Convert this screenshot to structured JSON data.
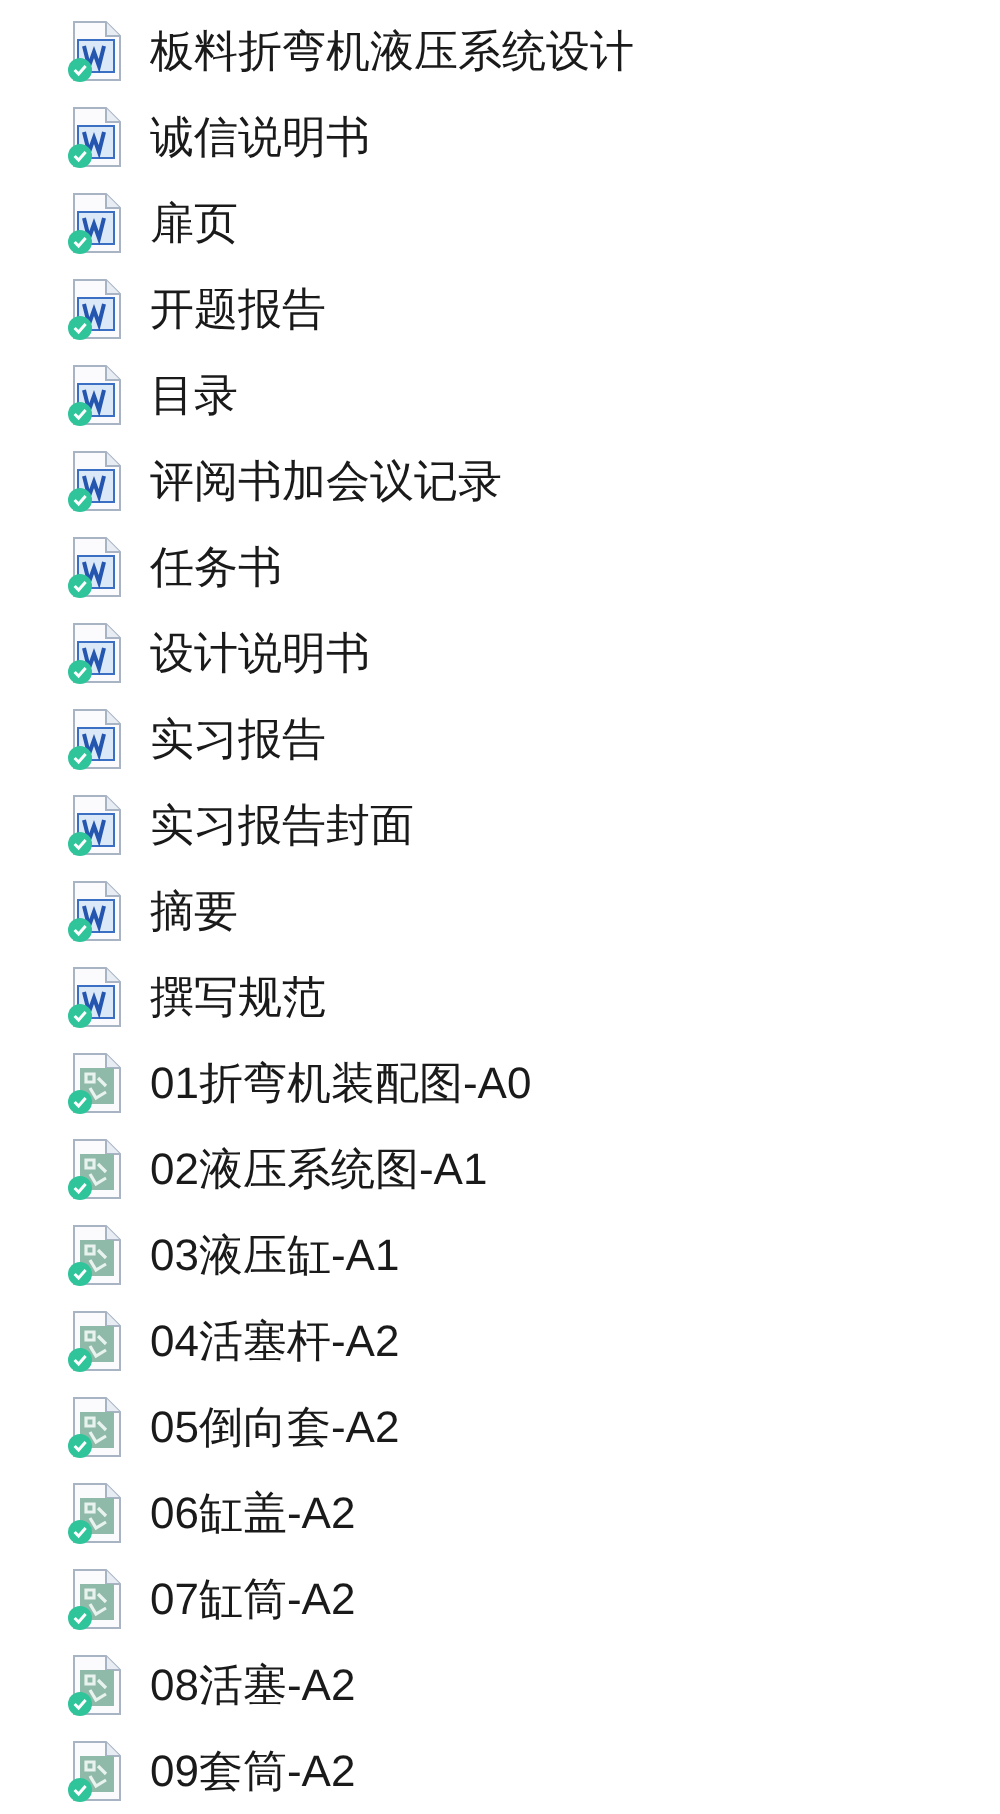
{
  "files": [
    {
      "name": "板料折弯机液压系统设计",
      "kind": "word",
      "synced": true
    },
    {
      "name": "诚信说明书",
      "kind": "word",
      "synced": true
    },
    {
      "name": "扉页",
      "kind": "word",
      "synced": true
    },
    {
      "name": "开题报告",
      "kind": "word",
      "synced": true
    },
    {
      "name": "目录",
      "kind": "word",
      "synced": true
    },
    {
      "name": "评阅书加会议记录",
      "kind": "word",
      "synced": true
    },
    {
      "name": "任务书",
      "kind": "word",
      "synced": true
    },
    {
      "name": "设计说明书",
      "kind": "word",
      "synced": true
    },
    {
      "name": "实习报告",
      "kind": "word",
      "synced": true
    },
    {
      "name": "实习报告封面",
      "kind": "word",
      "synced": true
    },
    {
      "name": "摘要",
      "kind": "word",
      "synced": true
    },
    {
      "name": "撰写规范",
      "kind": "word",
      "synced": true
    },
    {
      "name": "01折弯机装配图-A0",
      "kind": "drawing",
      "synced": true
    },
    {
      "name": "02液压系统图-A1",
      "kind": "drawing",
      "synced": true
    },
    {
      "name": "03液压缸-A1",
      "kind": "drawing",
      "synced": true
    },
    {
      "name": "04活塞杆-A2",
      "kind": "drawing",
      "synced": true
    },
    {
      "name": "05倒向套-A2",
      "kind": "drawing",
      "synced": true
    },
    {
      "name": "06缸盖-A2",
      "kind": "drawing",
      "synced": true
    },
    {
      "name": "07缸筒-A2",
      "kind": "drawing",
      "synced": true
    },
    {
      "name": "08活塞-A2",
      "kind": "drawing",
      "synced": true
    },
    {
      "name": "09套筒-A2",
      "kind": "drawing",
      "synced": true
    }
  ]
}
